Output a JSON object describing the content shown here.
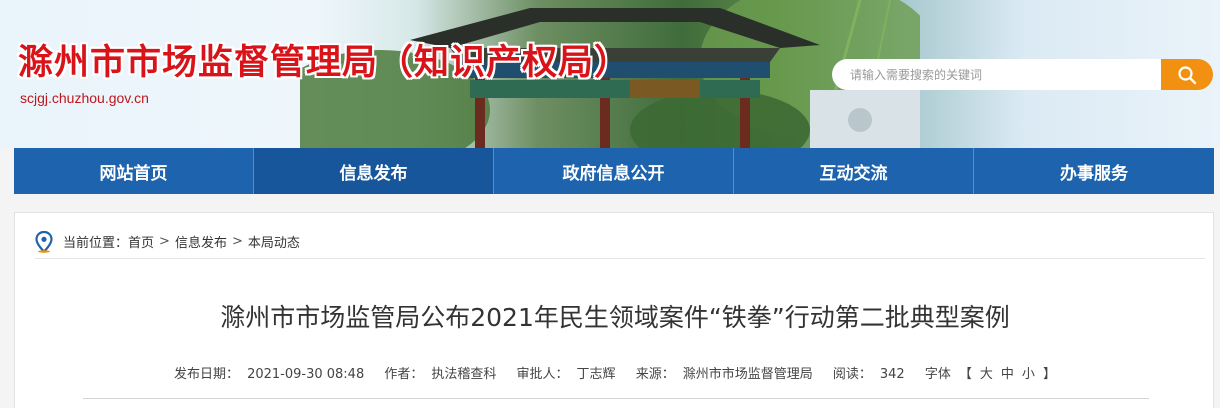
{
  "header": {
    "site_title": "滁州市市场监督管理局（知识产权局）",
    "site_domain": "scjgj.chuzhou.gov.cn",
    "search_placeholder": "请输入需要搜索的关键词",
    "search_icon": "search-icon"
  },
  "nav": {
    "items": [
      {
        "label": "网站首页",
        "active": false
      },
      {
        "label": "信息发布",
        "active": true
      },
      {
        "label": "政府信息公开",
        "active": false
      },
      {
        "label": "互动交流",
        "active": false
      },
      {
        "label": "办事服务",
        "active": false
      }
    ]
  },
  "breadcrumb": {
    "label": "当前位置：",
    "items": [
      "首页",
      "信息发布",
      "本局动态"
    ],
    "separator": ">",
    "icon": "location-pin-icon"
  },
  "article": {
    "title": "滁州市市场监管局公布2021年民生领域案件“铁拳”行动第二批典型案例",
    "publish_label": "发布日期：",
    "publish_date": "2021-09-30 08:48",
    "author_label": "作者：",
    "author": "执法稽查科",
    "reviewer_label": "审批人：",
    "reviewer": "丁志辉",
    "source_label": "来源：",
    "source": "滁州市市场监督管理局",
    "views_label": "阅读：",
    "views": "342",
    "font_label": "字体",
    "font_sizes": [
      "大",
      "中",
      "小"
    ],
    "bracket_open": "【",
    "bracket_close": "】"
  },
  "colors": {
    "title_red": "#d8141a",
    "nav_blue": "#1e63ad",
    "nav_active": "#17569b",
    "search_orange": "#f29111",
    "pin_blue": "#1e63ad"
  }
}
